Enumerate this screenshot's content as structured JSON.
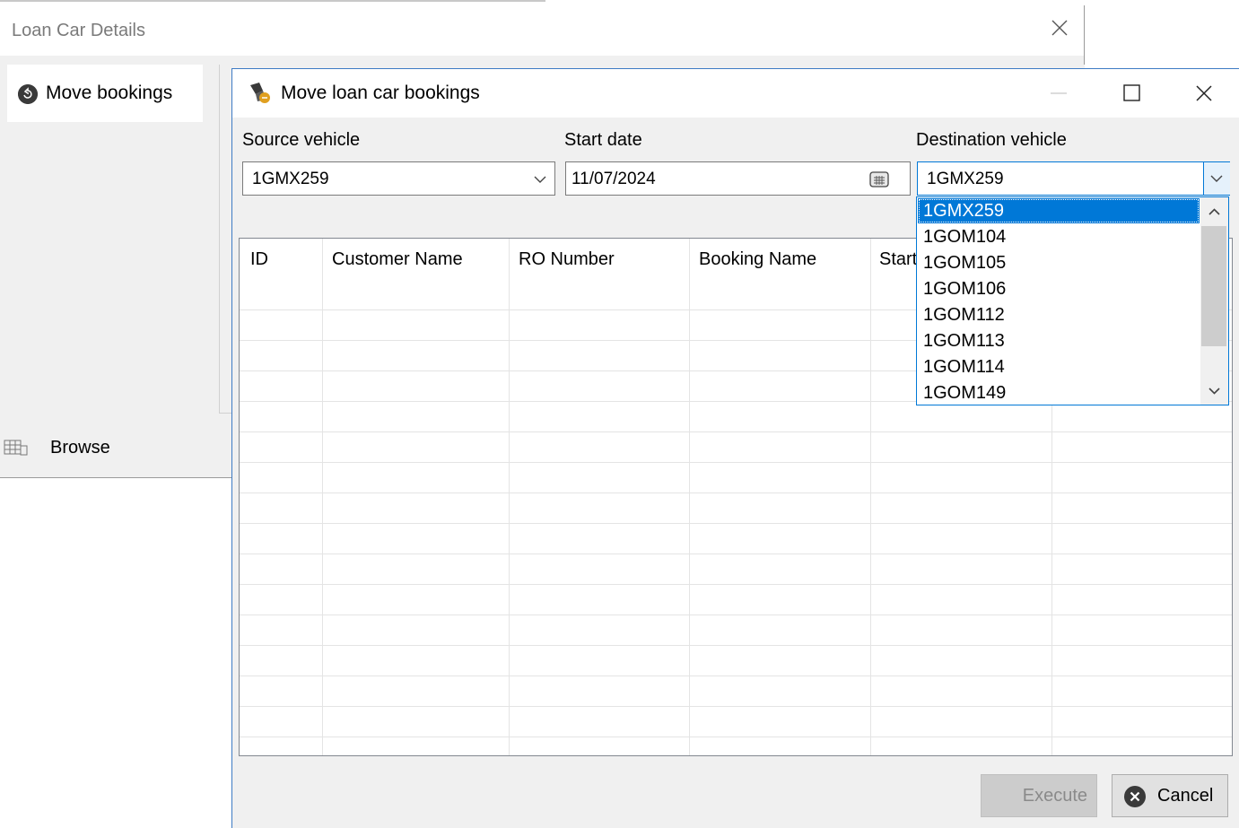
{
  "background_window": {
    "title": "Loan Car Details",
    "side_items": [
      {
        "label": "Move bookings",
        "icon": "move-bookings-icon"
      },
      {
        "label": "Browse",
        "icon": "browse-grid-icon"
      }
    ]
  },
  "dialog": {
    "title": "Move loan car bookings",
    "fields": {
      "source_vehicle": {
        "label": "Source vehicle",
        "value": "1GMX259"
      },
      "start_date": {
        "label": "Start date",
        "value": "11/07/2024"
      },
      "destination_vehicle": {
        "label": "Destination vehicle",
        "value": "1GMX259",
        "options": [
          "1GMX259",
          "1GOM104",
          "1GOM105",
          "1GOM106",
          "1GOM112",
          "1GOM113",
          "1GOM114",
          "1GOM149"
        ],
        "selected_index": 0
      }
    },
    "grid": {
      "columns": [
        "ID",
        "Customer Name",
        "RO Number",
        "Booking Name",
        "Start"
      ],
      "rows": []
    },
    "buttons": {
      "execute": "Execute",
      "cancel": "Cancel"
    }
  },
  "colors": {
    "accent": "#0078d7",
    "dialog_border": "#3e7bc4",
    "window_bg": "#f0f0f0",
    "disabled_button": "#cccccc"
  }
}
